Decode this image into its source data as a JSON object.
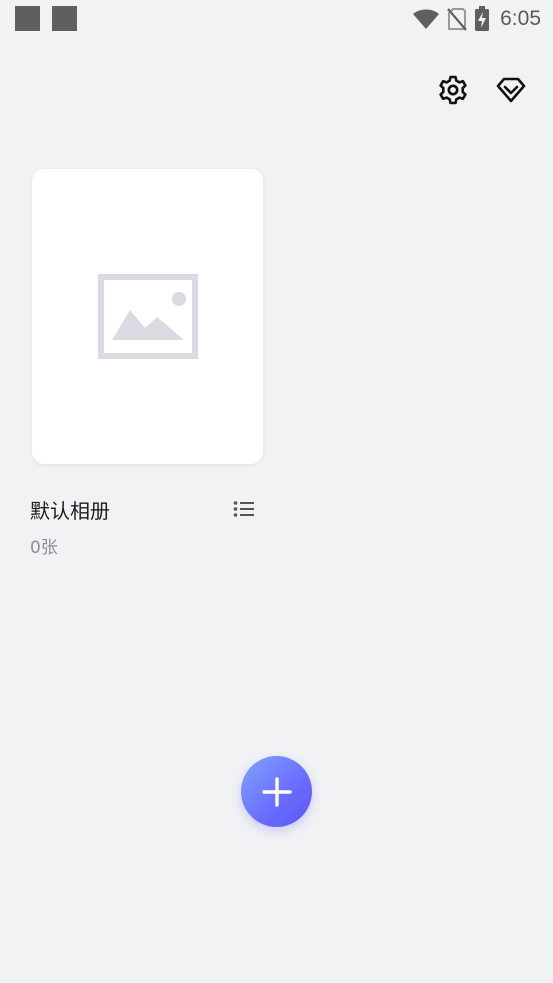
{
  "status_bar": {
    "time": "6:05",
    "left_icons": [
      "notification-square",
      "notification-square"
    ],
    "right_icons": [
      "wifi-icon",
      "no-sim-icon",
      "battery-charging-icon"
    ]
  },
  "top_actions": {
    "icons": [
      "gear-icon",
      "diamond-icon"
    ]
  },
  "album": {
    "name": "默认相册",
    "count": "0张",
    "thumbnail_icon": "image-placeholder-icon",
    "menu_icon": "list-icon"
  },
  "fab": {
    "icon": "plus-icon"
  },
  "colors": {
    "background": "#f1f2f4",
    "card": "#ffffff",
    "placeholder": "#d9dae2",
    "fab_start": "#7fa4ff",
    "fab_end": "#5d55f5",
    "text_primary": "#1d1d1f",
    "text_secondary": "#8c8c92"
  }
}
